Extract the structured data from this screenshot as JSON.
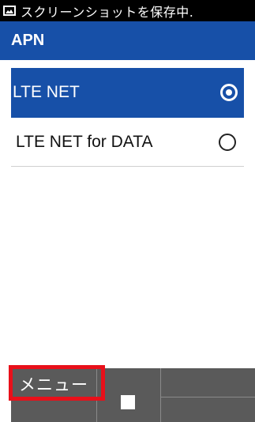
{
  "status_bar": {
    "text": "スクリーンショットを保存中.",
    "icon": "image-icon"
  },
  "header": {
    "title": "APN"
  },
  "apn_list": [
    {
      "label": "LTE NET",
      "selected": true
    },
    {
      "label": "LTE NET for DATA",
      "selected": false
    }
  ],
  "softkeys": {
    "left_label": "メニュー",
    "center_icon": "stop-icon"
  },
  "colors": {
    "accent": "#1750a8",
    "highlight": "#e8101a",
    "softkey_bar": "#5a5a5a"
  }
}
